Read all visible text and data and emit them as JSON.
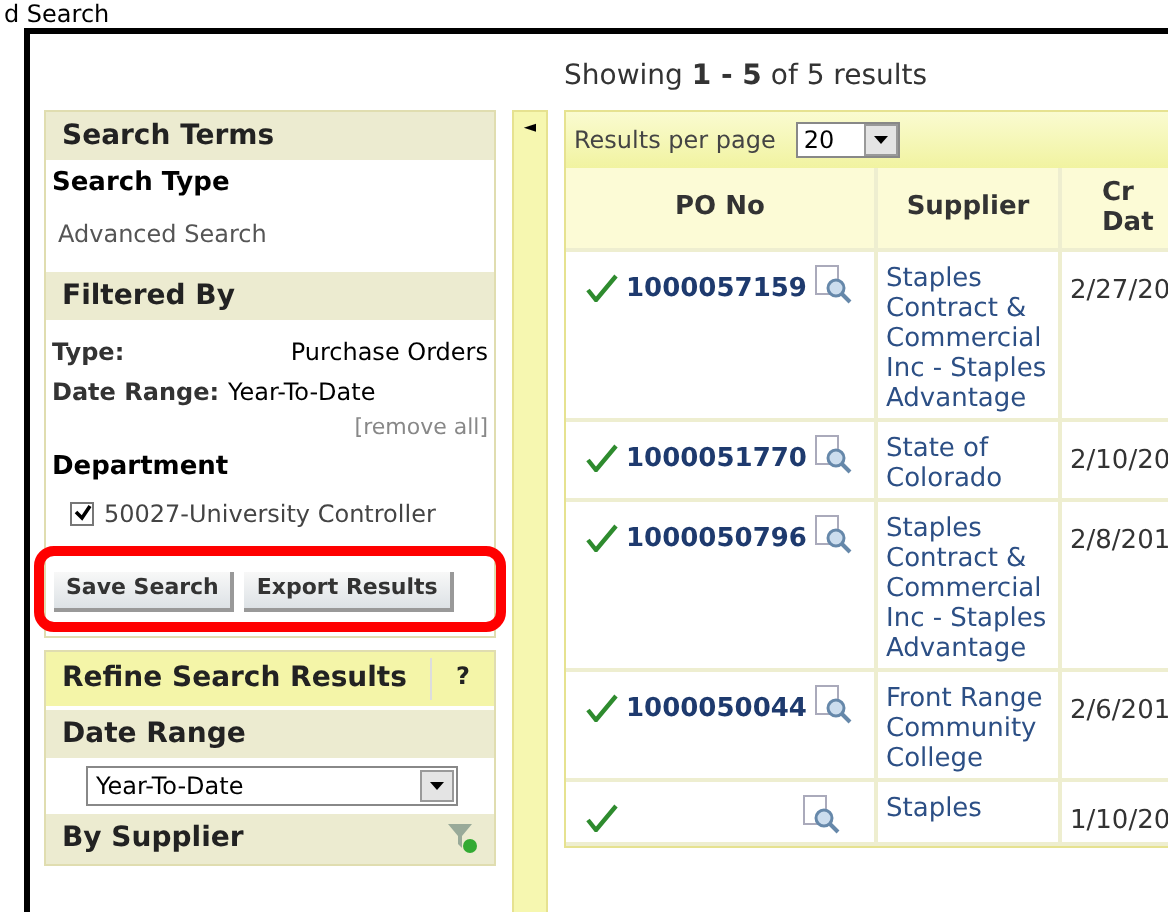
{
  "page_title": "d Search",
  "sidebar": {
    "search_terms": {
      "title": "Search Terms",
      "type_label": "Search Type",
      "type_value": "Advanced Search"
    },
    "filtered_by": {
      "title": "Filtered By",
      "filters": [
        {
          "label": "Type:",
          "value": "Purchase Orders"
        },
        {
          "label": "Date Range:",
          "value": "Year-To-Date"
        }
      ],
      "remove_all": "[remove all]",
      "department_label": "Department",
      "departments": [
        {
          "label": "50027-University Controller",
          "checked": true
        }
      ]
    },
    "buttons": [
      "Save Search",
      "Export Results"
    ],
    "refine": {
      "title": "Refine Search Results",
      "help": "?",
      "date_range_title": "Date Range",
      "date_range_value": "Year-To-Date",
      "supplier_title": "By Supplier"
    }
  },
  "collapse_arrow": "◄",
  "results": {
    "showing": "Showing **1 - 5** of 5 results",
    "per_page_label": "Results per page",
    "per_page_value": "20",
    "columns": [
      "PO No",
      "Supplier",
      "Cr Dat"
    ],
    "rows": [
      {
        "po": "1000057159",
        "supplier": "Staples Contract & Commercial Inc - Staples Advantage",
        "date": "2/27/20"
      },
      {
        "po": "1000051770",
        "supplier": "State of Colorado",
        "date": "2/10/20"
      },
      {
        "po": "1000050796",
        "supplier": "Staples Contract & Commercial Inc - Staples Advantage",
        "date": "2/8/201"
      },
      {
        "po": "1000050044",
        "supplier": "Front Range Community College",
        "date": "2/6/201"
      },
      {
        "po": "",
        "supplier": "Staples",
        "date": "1/10/20"
      }
    ]
  }
}
